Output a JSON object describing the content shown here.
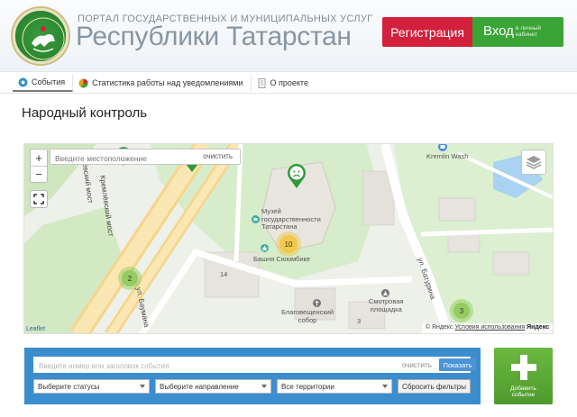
{
  "header": {
    "portal_top": "ПОРТАЛ ГОСУДАРСТВЕННЫХ И МУНИЦИПАЛЬНЫХ УСЛУГ",
    "portal_main": "Республики Татарстан",
    "register_label": "Регистрация",
    "login_label": "Вход",
    "login_sub_1": "в личный",
    "login_sub_2": "кабинет"
  },
  "tabs": [
    {
      "label": "События"
    },
    {
      "label": "Статистика работы над уведомлениями"
    },
    {
      "label": "О проекте"
    }
  ],
  "page_title": "Народный контроль",
  "map": {
    "location_placeholder": "Введите местоположение",
    "clear_label": "очистить",
    "zoom_in": "+",
    "zoom_out": "−",
    "labels": {
      "museum_1": "Музей",
      "museum_2": "государственности",
      "museum_3": "Татарстана",
      "tower": "Башня Сююмбике",
      "viewing_1": "Смотровая",
      "viewing_2": "площадка",
      "cathedral_1": "Благовещенский",
      "cathedral_2": "собор",
      "kremlin_wash": "Kremlin Wash",
      "house_14": "14",
      "house_3": "3",
      "bridge_1": "Кремлёвский мост",
      "bridge_2": "лёвский мост",
      "street_1": "ул. Батурина",
      "street_2": "ул. Баумана"
    },
    "clusters": [
      {
        "count": "10"
      },
      {
        "count": "2"
      },
      {
        "count": "3"
      }
    ],
    "leaflet": "Leaflet",
    "attribution_prefix": "© Яндекс",
    "attribution_terms": "Условия использования",
    "attribution_brand": "Яндекс"
  },
  "filters": {
    "search_placeholder": "Введите номер или заголовок события",
    "clear_label": "очистить",
    "show_label": "Показать",
    "status_select": "Выберите статусы",
    "direction_select": "Выберите направление",
    "territory_select": "Все территории",
    "reset_label": "Сбросить фильтры"
  },
  "add_event": {
    "label_1": "Добавить",
    "label_2": "событие"
  },
  "colors": {
    "register": "#d3203c",
    "login": "#3aa536",
    "panel": "#3c8dce",
    "add": "#5aa835",
    "marker": "#2f9a3a"
  }
}
